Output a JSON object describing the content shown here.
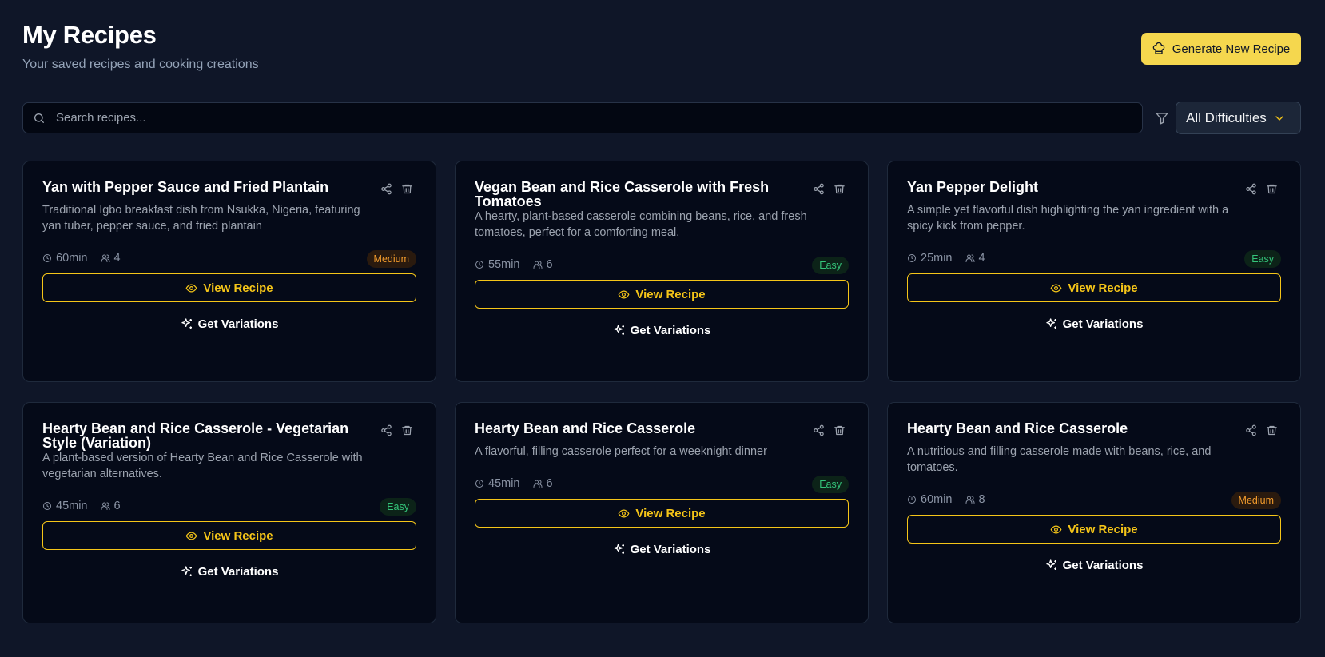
{
  "header": {
    "title": "My Recipes",
    "subtitle": "Your saved recipes and cooking creations",
    "generate_label": "Generate New Recipe"
  },
  "search": {
    "placeholder": "Search recipes...",
    "value": ""
  },
  "filter": {
    "selected": "All Difficulties"
  },
  "labels": {
    "view": "View Recipe",
    "variations": "Get Variations"
  },
  "colors": {
    "accent": "#f5c518",
    "primary_button": "#f5d74e",
    "medium": "#f29b2c",
    "easy": "#34c47a",
    "background": "#0f1628",
    "card": "#050a18"
  },
  "recipes": [
    {
      "title": "Yan with Pepper Sauce and Fried Plantain",
      "description": "Traditional Igbo breakfast dish from Nsukka, Nigeria, featuring yan tuber, pepper sauce, and fried plantain",
      "time": "60min",
      "servings": "4",
      "difficulty": "Medium"
    },
    {
      "title": "Vegan Bean and Rice Casserole with Fresh Tomatoes",
      "description": "A hearty, plant-based casserole combining beans, rice, and fresh tomatoes, perfect for a comforting meal.",
      "time": "55min",
      "servings": "6",
      "difficulty": "Easy"
    },
    {
      "title": "Yan Pepper Delight",
      "description": "A simple yet flavorful dish highlighting the yan ingredient with a spicy kick from pepper.",
      "time": "25min",
      "servings": "4",
      "difficulty": "Easy"
    },
    {
      "title": "Hearty Bean and Rice Casserole - Vegetarian Style (Variation)",
      "description": "A plant-based version of Hearty Bean and Rice Casserole with vegetarian alternatives.",
      "time": "45min",
      "servings": "6",
      "difficulty": "Easy"
    },
    {
      "title": "Hearty Bean and Rice Casserole",
      "description": "A flavorful, filling casserole perfect for a weeknight dinner",
      "time": "45min",
      "servings": "6",
      "difficulty": "Easy"
    },
    {
      "title": "Hearty Bean and Rice Casserole",
      "description": "A nutritious and filling casserole made with beans, rice, and tomatoes.",
      "time": "60min",
      "servings": "8",
      "difficulty": "Medium"
    }
  ]
}
